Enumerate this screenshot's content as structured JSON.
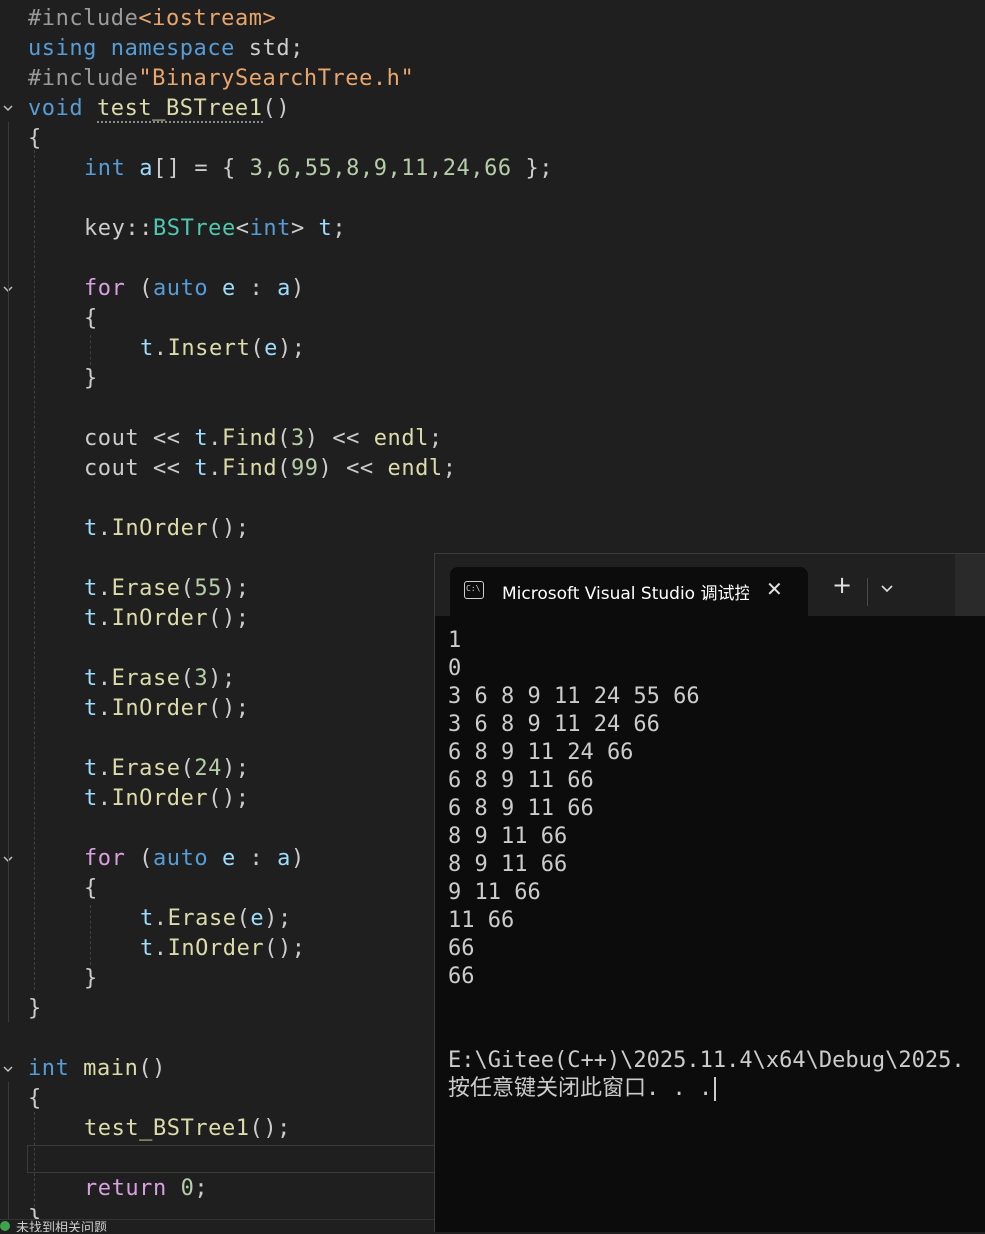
{
  "editor": {
    "lines": {
      "l1a": "#include",
      "l1b": "<iostream>",
      "l2a": "using",
      "l2b": "namespace",
      "l2c": "std;",
      "l3a": "#include",
      "l3b": "\"BinarySearchTree.h\"",
      "l4a": "void",
      "l4b": "test_BSTree1",
      "l4c": "()",
      "l5": "{",
      "l6a": "int",
      "l6b": "a",
      "l6c": "[] = { ",
      "l6d": "3,6,55,8,9,11,24,66",
      "l6e": " };",
      "l8a": "key",
      "l8b": "::",
      "l8c": "BSTree",
      "l8d": "<",
      "l8e": "int",
      "l8f": "> ",
      "l8g": "t",
      "l8h": ";",
      "l10a": "for",
      "l10b": " (",
      "l10c": "auto",
      "l10d": " e",
      "l10e": " : ",
      "l10f": "a",
      "l10g": ")",
      "l11": "{",
      "l12a": "t",
      "l12b": ".",
      "l12c": "Insert",
      "l12d": "(",
      "l12e": "e",
      "l12f": ");",
      "l13": "}",
      "l15a": "cout",
      "l15b": " << ",
      "l15c": "t",
      "l15d": ".",
      "l15e": "Find",
      "l15f": "(",
      "l15g": "3",
      "l15h": ") << ",
      "l15i": "endl",
      "l15j": ";",
      "l16a": "cout",
      "l16b": " << ",
      "l16c": "t",
      "l16d": ".",
      "l16e": "Find",
      "l16f": "(",
      "l16g": "99",
      "l16h": ") << ",
      "l16i": "endl",
      "l16j": ";",
      "l18a": "t",
      "l18b": ".",
      "l18c": "InOrder",
      "l18d": "();",
      "l20a": "t",
      "l20b": ".",
      "l20c": "Erase",
      "l20d": "(",
      "l20e": "55",
      "l20f": ");",
      "l21a": "t",
      "l21b": ".",
      "l21c": "InOrder",
      "l21d": "();",
      "l23a": "t",
      "l23b": ".",
      "l23c": "Erase",
      "l23d": "(",
      "l23e": "3",
      "l23f": ");",
      "l24a": "t",
      "l24b": ".",
      "l24c": "InOrder",
      "l24d": "();",
      "l26a": "t",
      "l26b": ".",
      "l26c": "Erase",
      "l26d": "(",
      "l26e": "24",
      "l26f": ");",
      "l27a": "t",
      "l27b": ".",
      "l27c": "InOrder",
      "l27d": "();",
      "l29a": "for",
      "l29b": " (",
      "l29c": "auto",
      "l29d": " e",
      "l29e": " : ",
      "l29f": "a",
      "l29g": ")",
      "l30": "{",
      "l31a": "t",
      "l31b": ".",
      "l31c": "Erase",
      "l31d": "(",
      "l31e": "e",
      "l31f": ");",
      "l32a": "t",
      "l32b": ".",
      "l32c": "InOrder",
      "l32d": "();",
      "l33": "}",
      "l34": "}",
      "l36a": "int",
      "l36b": " main",
      "l36c": "()",
      "l37": "{",
      "l38a": "test_BSTree1",
      "l38b": "();",
      "l40a": "return",
      "l40b": " 0",
      "l40c": ";",
      "l41": "}"
    },
    "status_text": "未找到相关问题"
  },
  "console": {
    "tab_title": "Microsoft Visual Studio 调试控",
    "close_glyph": "✕",
    "new_tab_glyph": "+",
    "dropdown_glyph": "⌄",
    "output": [
      "1",
      "0",
      "3 6 8 9 11 24 55 66",
      "3 6 8 9 11 24 66",
      "6 8 9 11 24 66",
      "6 8 9 11 66",
      "6 8 9 11 66",
      "8 9 11 66",
      "8 9 11 66",
      "9 11 66",
      "11 66",
      "66",
      "66"
    ],
    "path_line": "E:\\Gitee(C++)\\2025.11.4\\x64\\Debug\\2025.",
    "prompt_line": "按任意键关闭此窗口. . ."
  }
}
